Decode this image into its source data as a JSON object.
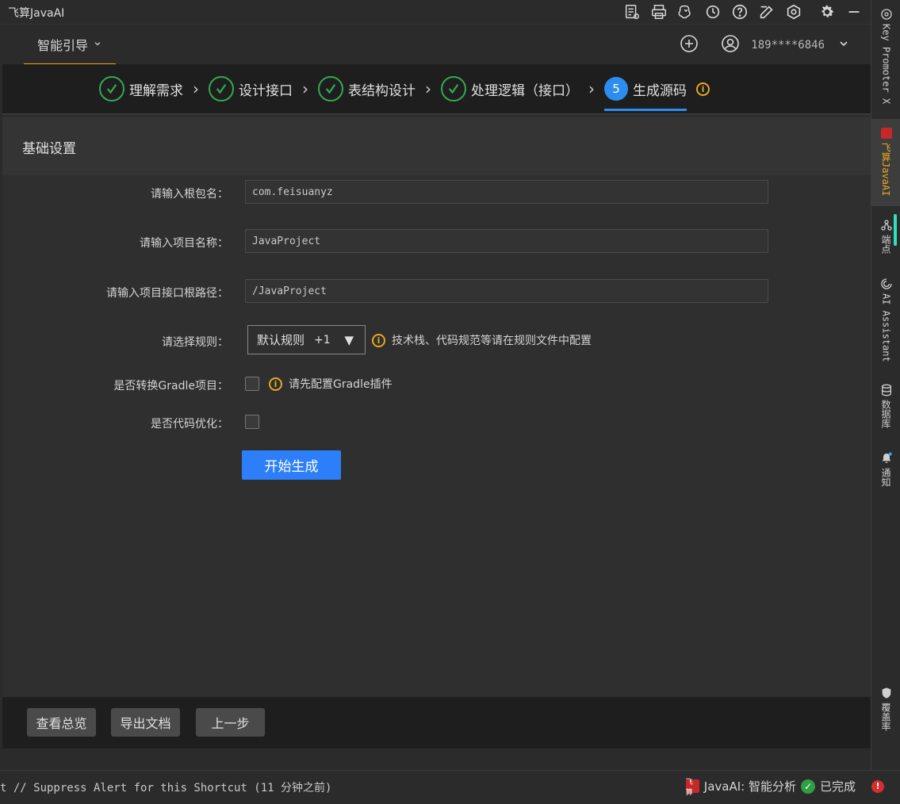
{
  "window": {
    "title": "飞算JavaAI"
  },
  "titlebar_icons": [
    "document-settings-icon",
    "printer-icon",
    "brain-icon",
    "history-icon",
    "help-icon",
    "edit-icon",
    "hexagon-icon",
    "gear-icon",
    "minimize-icon"
  ],
  "header": {
    "tab_label": "智能引导",
    "user": "189****6846"
  },
  "steps": [
    {
      "label": "理解需求",
      "state": "done"
    },
    {
      "label": "设计接口",
      "state": "done"
    },
    {
      "label": "表结构设计",
      "state": "done"
    },
    {
      "label": "处理逻辑（接口）",
      "state": "done"
    },
    {
      "label": "生成源码",
      "state": "active",
      "number": "5"
    }
  ],
  "section": {
    "title": "基础设置"
  },
  "form": {
    "root_package": {
      "label": "请输入根包名：",
      "value": "com.feisuanyz"
    },
    "project_name": {
      "label": "请输入项目名称：",
      "value": "JavaProject"
    },
    "api_root_path": {
      "label": "请输入项目接口根路径：",
      "value": "/JavaProject"
    },
    "rules": {
      "label": "请选择规则：",
      "selected": "默认规则",
      "extra": "+1",
      "hint": "技术栈、代码规范等请在规则文件中配置"
    },
    "gradle": {
      "label": "是否转换Gradle项目：",
      "hint": "请先配置Gradle插件",
      "checked": false
    },
    "optimize": {
      "label": "是否代码优化：",
      "checked": false
    },
    "start_button": "开始生成"
  },
  "footer": {
    "overview_button": "查看总览",
    "export_button": "导出文档",
    "prev_button": "上一步"
  },
  "statusbar": {
    "message": "t // Suppress Alert for this Shortcut (11 分钟之前)",
    "logo_text": "飞算",
    "plugin_status": "JavaAI: 智能分析",
    "done_text": "已完成"
  },
  "toolstrip": [
    {
      "label": "Key Promoter X",
      "icon": "key-promoter-icon"
    },
    {
      "label": "飞算JavaAI",
      "icon": "feisuan-logo-icon",
      "active": true
    },
    {
      "label": "端点",
      "icon": "endpoints-icon"
    },
    {
      "label": "AI Assistant",
      "icon": "ai-assistant-icon"
    },
    {
      "label": "数据库",
      "icon": "database-icon"
    },
    {
      "label": "通知",
      "icon": "bell-icon"
    },
    {
      "label": "覆盖率",
      "icon": "shield-icon"
    }
  ],
  "colors": {
    "accent_blue": "#2d7ff9",
    "success_green": "#34a853",
    "warning_orange": "#e5a823",
    "background": "#2b2b2b"
  }
}
